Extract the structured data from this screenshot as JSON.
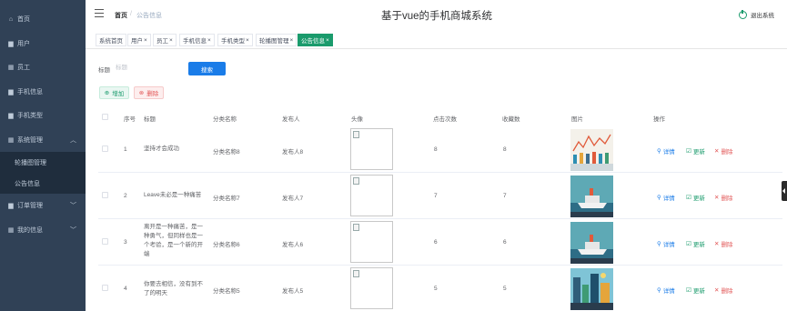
{
  "sidebar": {
    "items": [
      {
        "label": "首页",
        "icon": "home-icon"
      },
      {
        "label": "用户",
        "icon": "chat-icon"
      },
      {
        "label": "员工",
        "icon": "grid-icon"
      },
      {
        "label": "手机信息",
        "icon": "chat-icon"
      },
      {
        "label": "手机类型",
        "icon": "chat-icon"
      },
      {
        "label": "系统管理",
        "icon": "grid-icon"
      },
      {
        "label": "订单管理",
        "icon": "chat-icon"
      },
      {
        "label": "我的信息",
        "icon": "grid-icon"
      }
    ],
    "sub_items": [
      "轮播图管理",
      "公告信息"
    ]
  },
  "header": {
    "breadcrumb_home": "首页",
    "breadcrumb_sep": "/",
    "breadcrumb_current": "公告信息",
    "title": "基于vue的手机商城系统",
    "logout": "退出系统"
  },
  "tags": [
    {
      "label": "系统首页",
      "closable": false
    },
    {
      "label": "用户",
      "closable": true
    },
    {
      "label": "员工",
      "closable": true
    },
    {
      "label": "手机信息",
      "closable": true
    },
    {
      "label": "手机类型",
      "closable": true
    },
    {
      "label": "轮播图管理",
      "closable": true
    },
    {
      "label": "公告信息",
      "closable": true,
      "active": true
    }
  ],
  "search": {
    "label": "标题",
    "placeholder": "标题",
    "button": "搜索"
  },
  "actions": {
    "add": "增加",
    "delete": "删除"
  },
  "table": {
    "columns": [
      "序号",
      "标题",
      "分类名称",
      "发布人",
      "头像",
      "点击次数",
      "收藏数",
      "图片",
      "操作"
    ],
    "ops": {
      "detail": "详情",
      "update": "更新",
      "remove": "删除"
    },
    "rows": [
      {
        "index": "1",
        "title": "坚持才会成功",
        "category": "分类名称8",
        "publisher": "发布人8",
        "clicks": "8",
        "favorites": "8",
        "picture": "chart-people"
      },
      {
        "index": "2",
        "title": "Leave未必是一种痛苦",
        "category": "分类名称7",
        "publisher": "发布人7",
        "clicks": "7",
        "favorites": "7",
        "picture": "ship"
      },
      {
        "index": "3",
        "title": "离开是一种痛苦，是一种勇气，但同样也是一个考验，是一个新的开端",
        "category": "分类名称6",
        "publisher": "发布人6",
        "clicks": "6",
        "favorites": "6",
        "picture": "ship"
      },
      {
        "index": "4",
        "title": "你要去相信，没有到不了的明天",
        "category": "分类名称5",
        "publisher": "发布人5",
        "clicks": "5",
        "favorites": "5",
        "picture": "city"
      }
    ]
  },
  "colors": {
    "sidebar_bg": "#304156",
    "submenu_bg": "#1f2d3d",
    "primary": "#1a7ce8",
    "success": "#1a9b6c",
    "danger": "#e25757"
  }
}
